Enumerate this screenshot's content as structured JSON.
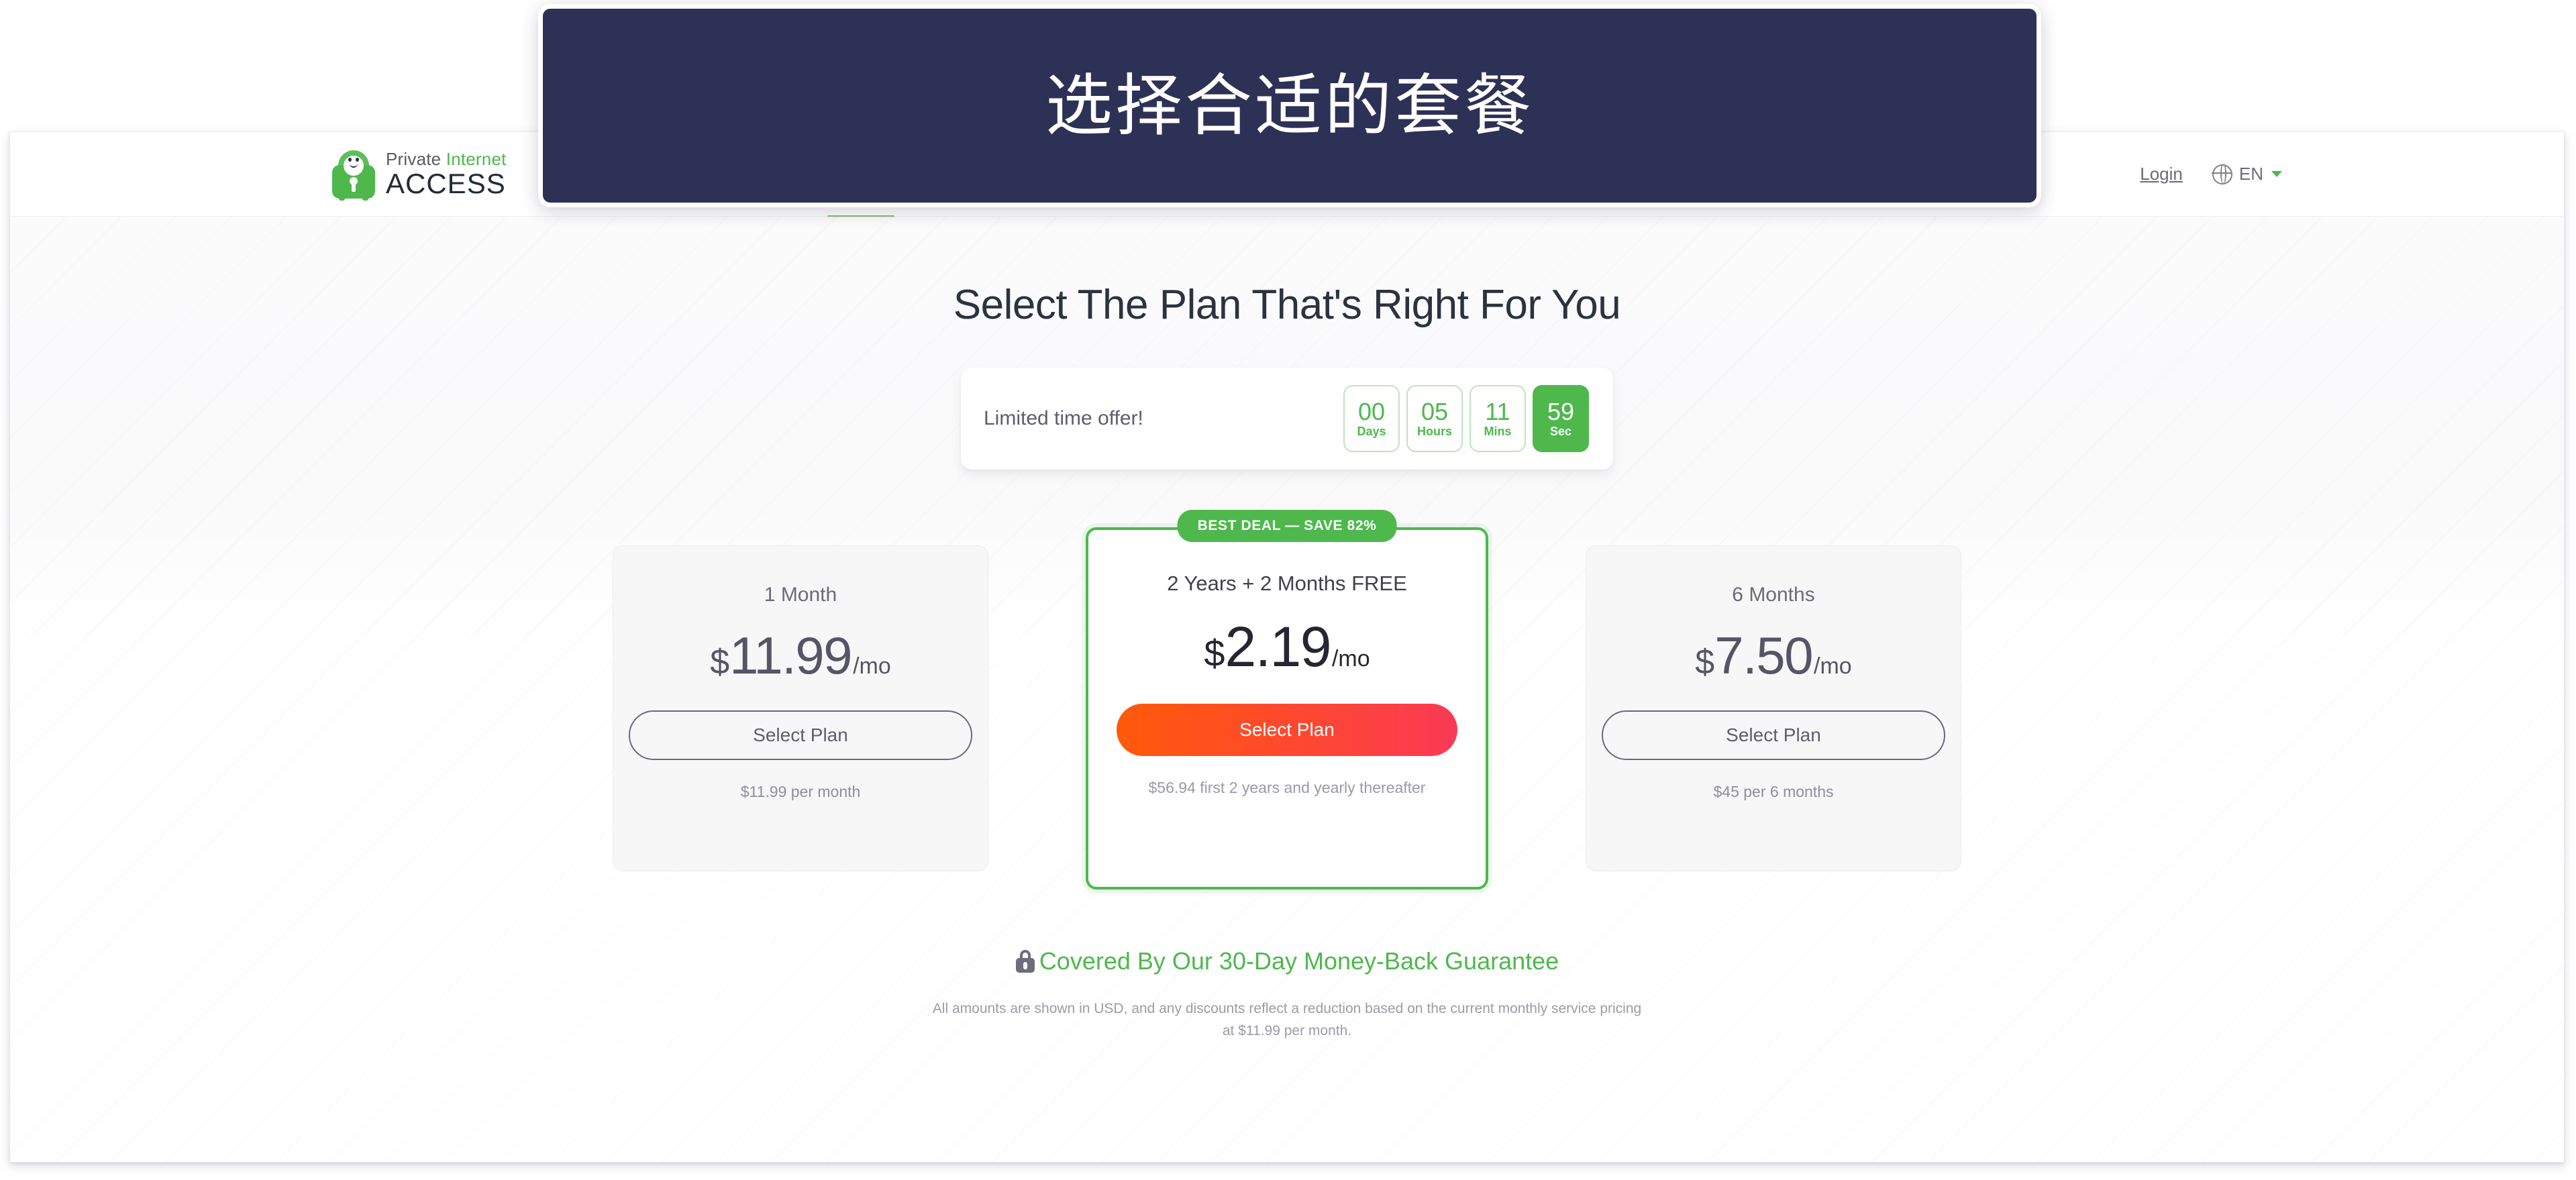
{
  "overlay": {
    "title": "选择合适的套餐",
    "background_color": "#2e3156",
    "text_color": "#ffffff"
  },
  "brand": {
    "icon": "pia-padlock-robot-icon",
    "line1_word1": "Private",
    "line1_word2": "Internet",
    "line2": "ACCESS",
    "green": "#4eb84d"
  },
  "header": {
    "login_label": "Login",
    "globe_icon": "globe-icon",
    "language_code": "EN",
    "caret_icon": "chevron-down-icon"
  },
  "main": {
    "title": "Select The Plan That's Right For You"
  },
  "countdown": {
    "label": "Limited time offer!",
    "boxes": [
      {
        "value": "00",
        "unit": "Days",
        "active": false
      },
      {
        "value": "05",
        "unit": "Hours",
        "active": false
      },
      {
        "value": "11",
        "unit": "Mins",
        "active": false
      },
      {
        "value": "59",
        "unit": "Sec",
        "active": true
      }
    ]
  },
  "plans": [
    {
      "name": "1 Month",
      "currency": "$",
      "amount": "11.99",
      "period": "/mo",
      "button_label": "Select Plan",
      "note": "$11.99 per month",
      "featured": false
    },
    {
      "badge": "BEST DEAL — SAVE 82%",
      "name": "2 Years + 2 Months FREE",
      "currency": "$",
      "amount": "2.19",
      "period": "/mo",
      "button_label": "Select Plan",
      "note": "$56.94 first 2 years and yearly thereafter",
      "featured": true
    },
    {
      "name": "6 Months",
      "currency": "$",
      "amount": "7.50",
      "period": "/mo",
      "button_label": "Select Plan",
      "note": "$45 per 6 months",
      "featured": false
    }
  ],
  "guarantee": {
    "icon": "lock-icon",
    "text": "Covered By Our 30-Day Money-Back Guarantee",
    "color": "#4eb84d"
  },
  "fineprint": {
    "text": "All amounts are shown in USD, and any discounts reflect a reduction based on the current monthly service pricing at $11.99 per month."
  },
  "colors": {
    "brand_green": "#4eb84d",
    "cta_orange": "#ff5a0a",
    "cta_red": "#fa3a55",
    "overlay_navy": "#2e3156"
  }
}
